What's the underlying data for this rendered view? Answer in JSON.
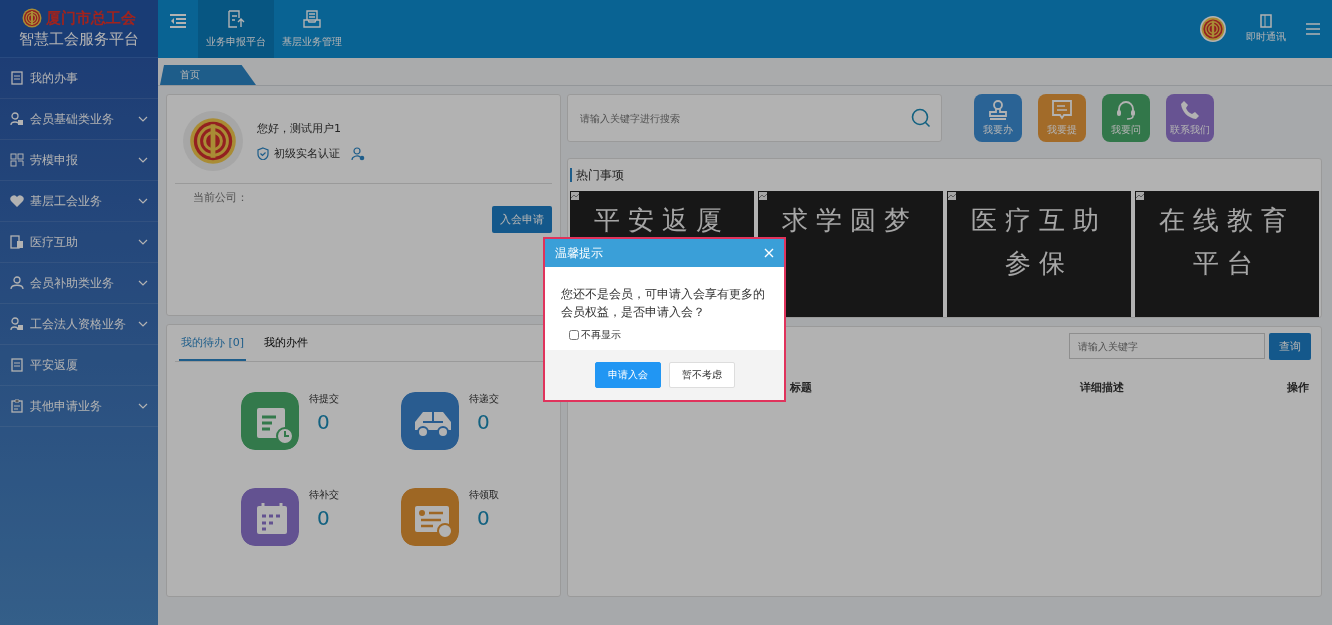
{
  "sidebar": {
    "logo_title": "厦门市总工会",
    "logo_subtitle": "智慧工会服务平台",
    "items": [
      {
        "label": "我的办事",
        "expandable": false
      },
      {
        "label": "会员基础类业务",
        "expandable": true
      },
      {
        "label": "劳模申报",
        "expandable": true
      },
      {
        "label": "基层工会业务",
        "expandable": true
      },
      {
        "label": "医疗互助",
        "expandable": true
      },
      {
        "label": "会员补助类业务",
        "expandable": true
      },
      {
        "label": "工会法人资格业务",
        "expandable": true
      },
      {
        "label": "平安返厦",
        "expandable": false
      },
      {
        "label": "其他申请业务",
        "expandable": true
      }
    ]
  },
  "header": {
    "nav": [
      {
        "label": "业务申报平台",
        "selected": true
      },
      {
        "label": "基层业务管理",
        "selected": false
      }
    ],
    "chat_label": "即时通讯"
  },
  "page_tabs": [
    {
      "label": "首页",
      "selected": true
    }
  ],
  "profile": {
    "greeting": "您好，测试用户1",
    "verification": "初级实名认证",
    "company_label": "当前公司：",
    "join_button": "入会申请"
  },
  "tasks": {
    "tabs": [
      {
        "label": "我的待办 [0]",
        "selected": true
      },
      {
        "label": "我的办件",
        "selected": false
      }
    ],
    "stats": [
      {
        "label": "待提交",
        "count": "0"
      },
      {
        "label": "待递交",
        "count": "0"
      },
      {
        "label": "待补交",
        "count": "0"
      },
      {
        "label": "待领取",
        "count": "0"
      }
    ]
  },
  "search": {
    "placeholder": "请输入关键字进行搜索"
  },
  "quick_actions": [
    {
      "label": "我要办"
    },
    {
      "label": "我要提"
    },
    {
      "label": "我要问"
    },
    {
      "label": "联系我们"
    }
  ],
  "hot": {
    "title": "热门事项",
    "tiles": [
      {
        "lines": [
          "平安返厦"
        ]
      },
      {
        "lines": [
          "求学圆梦"
        ]
      },
      {
        "lines": [
          "医疗互助",
          "参保"
        ]
      },
      {
        "lines": [
          "在线教育",
          "平台"
        ]
      }
    ]
  },
  "list": {
    "search_placeholder": "请输入关键字",
    "search_button": "查询",
    "columns": [
      "标题",
      "详细描述",
      "操作"
    ]
  },
  "dialog": {
    "title": "温馨提示",
    "message": "您还不是会员，可申请入会享有更多的会员权益，是否申请入会？",
    "dont_show": {
      "label": "不再显示",
      "checked": false
    },
    "buttons": [
      {
        "label": "申请入会",
        "kind": "primary"
      },
      {
        "label": "暂不考虑",
        "kind": "default"
      }
    ]
  }
}
